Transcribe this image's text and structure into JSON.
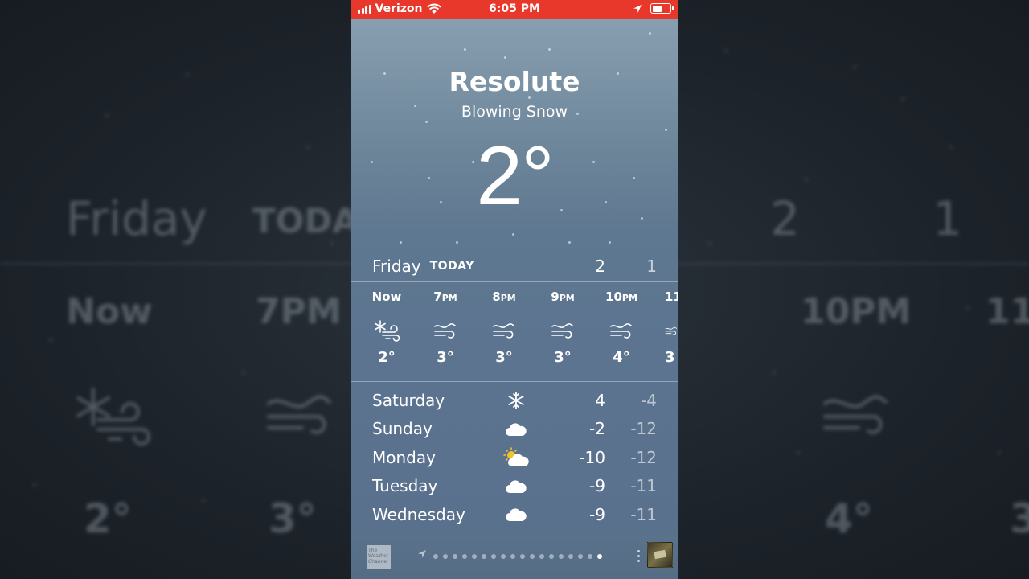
{
  "status_bar": {
    "carrier": "Verizon",
    "time": "6:05 PM"
  },
  "weather": {
    "city": "Resolute",
    "condition": "Blowing Snow",
    "temperature": "2°"
  },
  "today": {
    "day": "Friday",
    "tag": "TODAY",
    "high": "2",
    "low": "1"
  },
  "hourly": [
    {
      "label": "Now",
      "suffix": "",
      "icon": "snow-wind-icon",
      "temp": "2°"
    },
    {
      "label": "7",
      "suffix": "PM",
      "icon": "wind-icon",
      "temp": "3°"
    },
    {
      "label": "8",
      "suffix": "PM",
      "icon": "wind-icon",
      "temp": "3°"
    },
    {
      "label": "9",
      "suffix": "PM",
      "icon": "wind-icon",
      "temp": "3°"
    },
    {
      "label": "10",
      "suffix": "PM",
      "icon": "wind-icon",
      "temp": "4°"
    },
    {
      "label": "11",
      "suffix": "",
      "icon": "wind-icon",
      "temp": "3"
    }
  ],
  "daily": [
    {
      "day": "Saturday",
      "icon": "snowflake-icon",
      "high": "4",
      "low": "-4"
    },
    {
      "day": "Sunday",
      "icon": "cloud-icon",
      "high": "-2",
      "low": "-12"
    },
    {
      "day": "Monday",
      "icon": "partly-cloudy-icon",
      "high": "-10",
      "low": "-12"
    },
    {
      "day": "Tuesday",
      "icon": "cloud-icon",
      "high": "-9",
      "low": "-11"
    },
    {
      "day": "Wednesday",
      "icon": "cloud-icon",
      "high": "-9",
      "low": "-11"
    }
  ],
  "footer": {
    "logo_text": "The Weather Channel",
    "page_count": 18,
    "active_page": 18
  },
  "background": {
    "friday": "Friday",
    "today": "TODA",
    "now": "Now",
    "t7": "7PM",
    "t10": "10PM",
    "t11": "11",
    "hi": "2",
    "lo": "1",
    "temp_now": "2°",
    "temp_7": "3°",
    "temp_10": "4°",
    "temp_edge": "3"
  },
  "colors": {
    "status_bar": "#e8382b",
    "sun": "#f2c230"
  }
}
